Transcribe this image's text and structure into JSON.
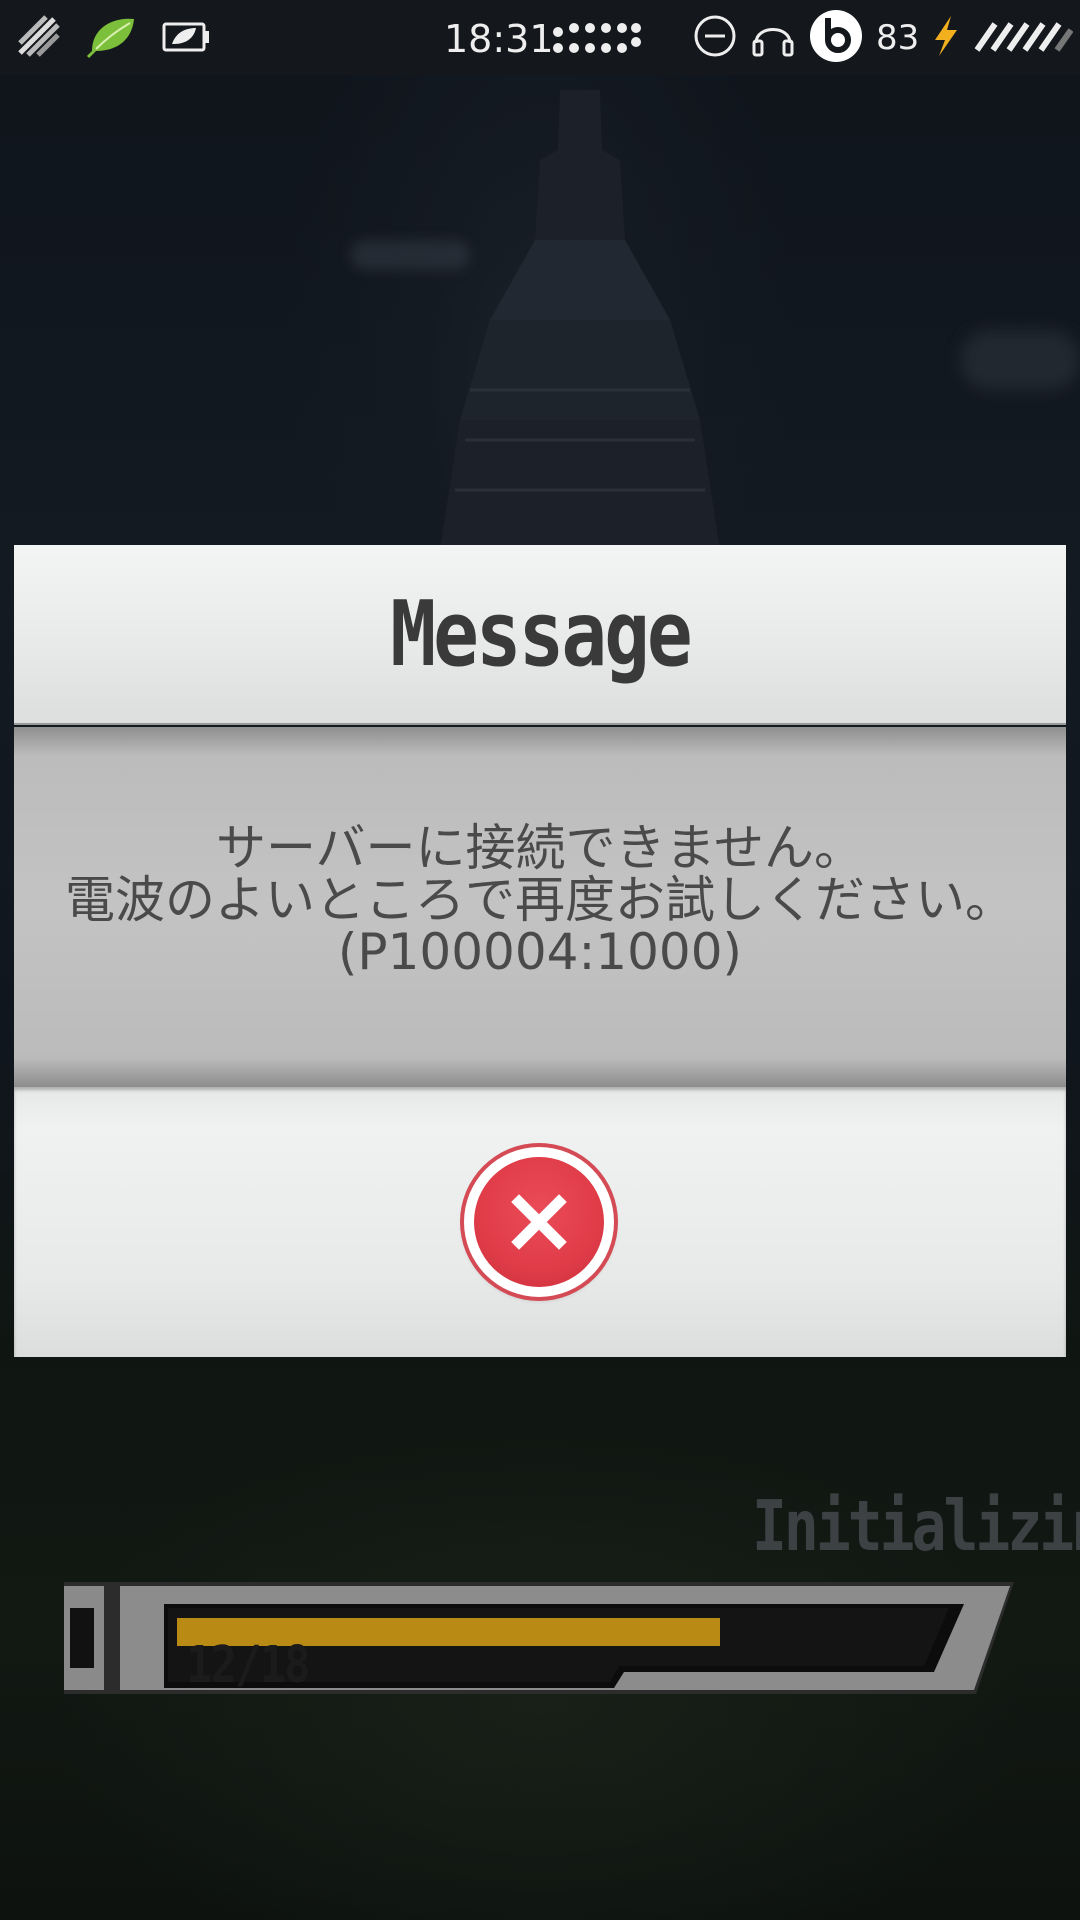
{
  "status_bar": {
    "time": "18:31",
    "battery_level": "83",
    "icons": [
      "signal-stripes-icon",
      "leaf-icon",
      "battery-saver-icon",
      "notification-dots-icon",
      "do-not-disturb-icon",
      "headphones-icon",
      "beats-icon",
      "charging-icon",
      "signal-strength-icon"
    ]
  },
  "dialog": {
    "title": "Message",
    "message_line1": "サーバーに接続できません。",
    "message_line2": "電波のよいところで再度お試しください。",
    "message_line3": "(P100004:1000)",
    "close_icon": "close-x-icon",
    "accent_color": "#df3c48"
  },
  "loading": {
    "label": "Initializing",
    "progress_text": "12/18",
    "progress_fraction": 0.6667,
    "bar_color": "#b98a14"
  }
}
